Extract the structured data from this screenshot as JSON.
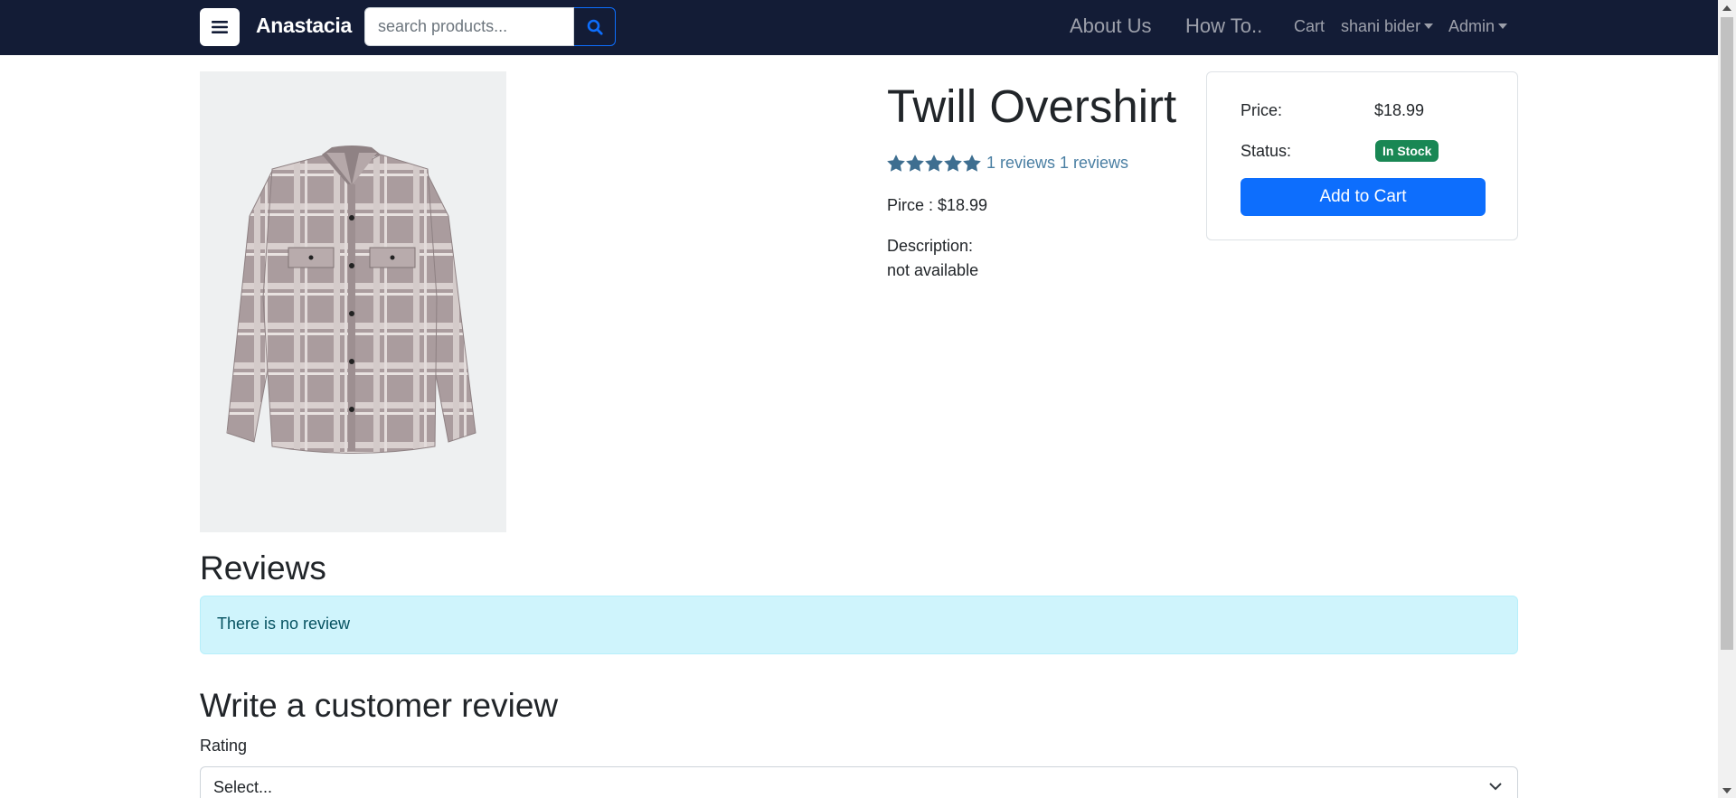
{
  "navbar": {
    "brand": "Anastacia",
    "search_placeholder": "search products...",
    "links": {
      "about": "About Us",
      "howto": "How To..",
      "cart": "Cart",
      "user": "shani bider",
      "admin": "Admin"
    }
  },
  "product": {
    "title": "Twill Overshirt",
    "rating_stars": 5,
    "reviews_text": "1 reviews 1 reviews",
    "price_line": "Pirce : $18.99",
    "description_label": "Description:",
    "description_value": "not available"
  },
  "card": {
    "price_label": "Price:",
    "price_value": "$18.99",
    "status_label": "Status:",
    "status_value": "In Stock",
    "add_button": "Add to Cart"
  },
  "reviews": {
    "heading": "Reviews",
    "empty_message": "There is no review",
    "write_heading": "Write a customer review",
    "rating_label": "Rating",
    "rating_select_value": "Select..."
  },
  "colors": {
    "navbar_bg": "#131c36",
    "primary": "#0d6efd",
    "success": "#198754",
    "star": "#3e6e90",
    "alert_bg": "#cff4fc"
  }
}
